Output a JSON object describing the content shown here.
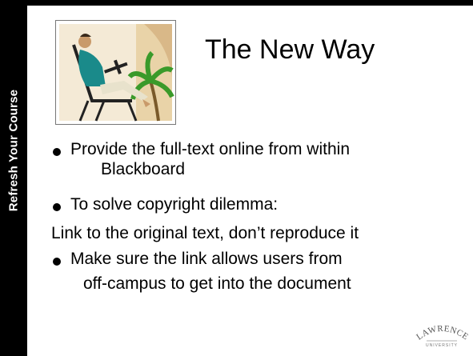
{
  "slide": {
    "sidebar_label": "Refresh Your Course",
    "title": "The New Way",
    "lines": [
      "Provide the full-text online from within",
      "Blackboard",
      "To solve copyright dilemma:",
      "Link to the original text, don’t reproduce it",
      "Make sure the link allows users from",
      "off-campus to get into the document"
    ]
  },
  "logo": {
    "word": "LAWRENCE",
    "sub": "UNIVERSITY"
  },
  "colors": {
    "background": "#ffffff",
    "sidebar": "#000000",
    "text": "#000000"
  }
}
